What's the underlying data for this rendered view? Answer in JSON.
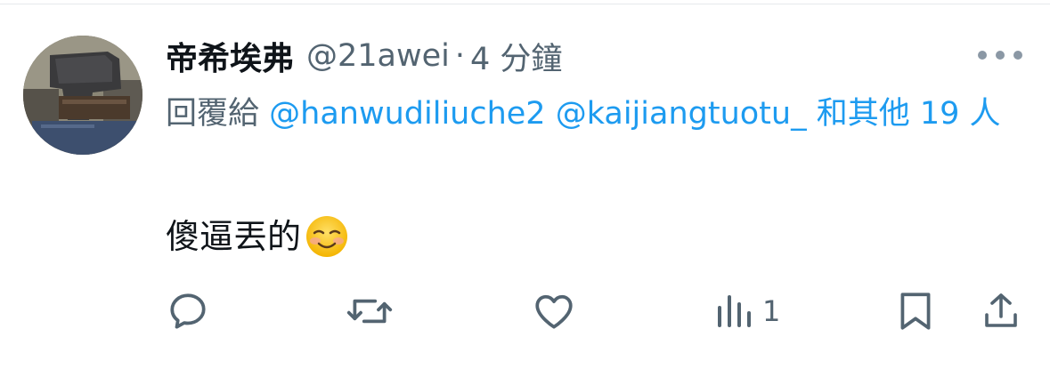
{
  "tweet": {
    "display_name": "帝希埃弗",
    "handle": "@21awei",
    "separator": "·",
    "time": "4 分鐘",
    "reply_prefix": "回覆給",
    "mentions": [
      "@hanwudiliuche2",
      "@kaijiangtuotu_"
    ],
    "others_text": "和其他 19 人",
    "body_text": "傻逼丟的",
    "emoji": "smiling-face-icon"
  },
  "actions": {
    "views_count": "1"
  },
  "colors": {
    "text_primary": "#0f1419",
    "text_secondary": "#536471",
    "link": "#1d9bf0",
    "icon": "#536471"
  }
}
